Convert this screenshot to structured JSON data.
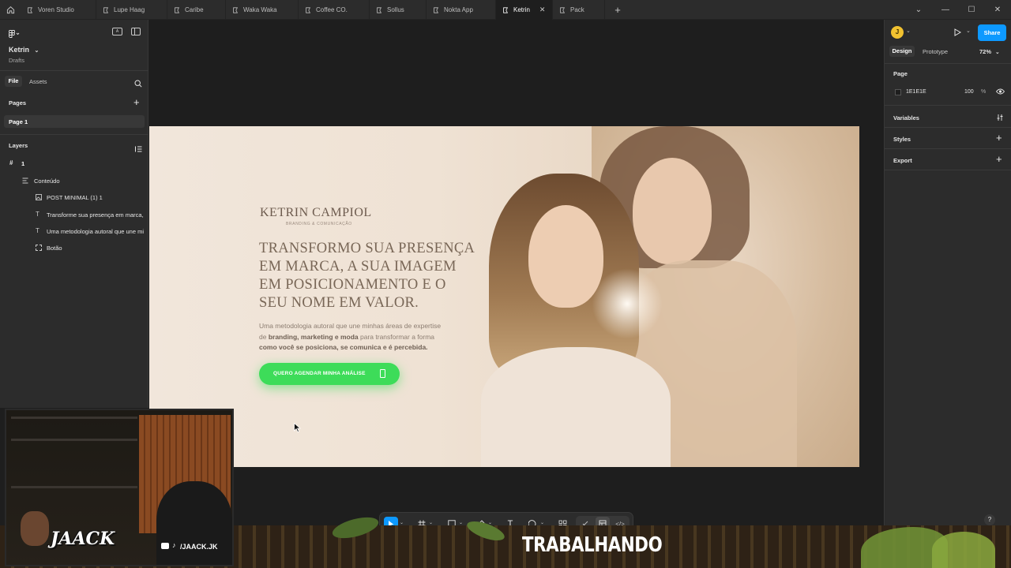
{
  "tabs": [
    {
      "label": "Voren Studio"
    },
    {
      "label": "Lupe Haag"
    },
    {
      "label": "Caribe"
    },
    {
      "label": "Waka Waka"
    },
    {
      "label": "Coffee CO."
    },
    {
      "label": "Sollus"
    },
    {
      "label": "Nokta App"
    },
    {
      "label": "Ketrin",
      "active": true
    },
    {
      "label": "Pack"
    }
  ],
  "window_controls": {
    "add": "+",
    "chevron": "⌄",
    "minimize": "—",
    "maximize": "☐",
    "close": "✕"
  },
  "left_panel": {
    "file_name": "Ketrin",
    "file_location": "Drafts",
    "tabs": {
      "file": "File",
      "assets": "Assets"
    },
    "pages_heading": "Pages",
    "pages": [
      "Page 1"
    ],
    "layers_heading": "Layers",
    "layers": [
      {
        "label": "1",
        "icon": "frame-hash-icon"
      },
      {
        "label": "Conteúdo",
        "icon": "auto-layout-icon"
      },
      {
        "label": "POST MINIMAL (1) 1",
        "icon": "image-icon"
      },
      {
        "label": "Transforme sua presença em marca,",
        "icon": "text-icon"
      },
      {
        "label": "Uma metodologia autoral que une mi",
        "icon": "text-icon"
      },
      {
        "label": "Botão",
        "icon": "frame-dashed-icon"
      }
    ]
  },
  "right_panel": {
    "avatar_letter": "J",
    "share_label": "Share",
    "tabs": {
      "design": "Design",
      "prototype": "Prototype"
    },
    "zoom": "72%",
    "page_heading": "Page",
    "page_color": "1E1E1E",
    "page_opacity": "100",
    "percent": "%",
    "sections": [
      "Variables",
      "Styles",
      "Export"
    ]
  },
  "frame_content": {
    "brand_name": "KETRIN CAMPIOL",
    "brand_sub": "BRANDING & COMUNICAÇÃO",
    "headline_lines": [
      "TRANSFORMO SUA PRESENÇA",
      "EM MARCA, A SUA IMAGEM",
      "EM POSICIONAMENTO E O",
      "SEU NOME EM VALOR."
    ],
    "body_line1": "Uma metodologia autoral que une minhas áreas de expertise",
    "body_line2_a": "de ",
    "body_line2_b": "branding, marketing e moda",
    "body_line2_c": " para transformar a forma",
    "body_line3": "como você se posiciona, se comunica e é percebida.",
    "cta_label": "QUERO AGENDAR MINHA ANÁLISE",
    "cta_color": "#3ddc59"
  },
  "toolbar": {
    "tools": [
      "move-tool-icon",
      "frame-tool-icon",
      "rectangle-tool-icon",
      "pen-tool-icon",
      "text-tool-icon",
      "ellipse-tool-icon",
      "components-icon",
      "draw-mode-icon",
      "design-mode-icon",
      "dev-mode-icon"
    ]
  },
  "help": "?",
  "stream_overlay": {
    "channel_logo": "JAACK",
    "handle": "/JAACK.JK",
    "status": "TRABALHANDO"
  },
  "colors": {
    "accent_blue": "#0d99ff",
    "panel_bg": "#2c2c2c",
    "canvas_bg": "#1e1e1e"
  }
}
